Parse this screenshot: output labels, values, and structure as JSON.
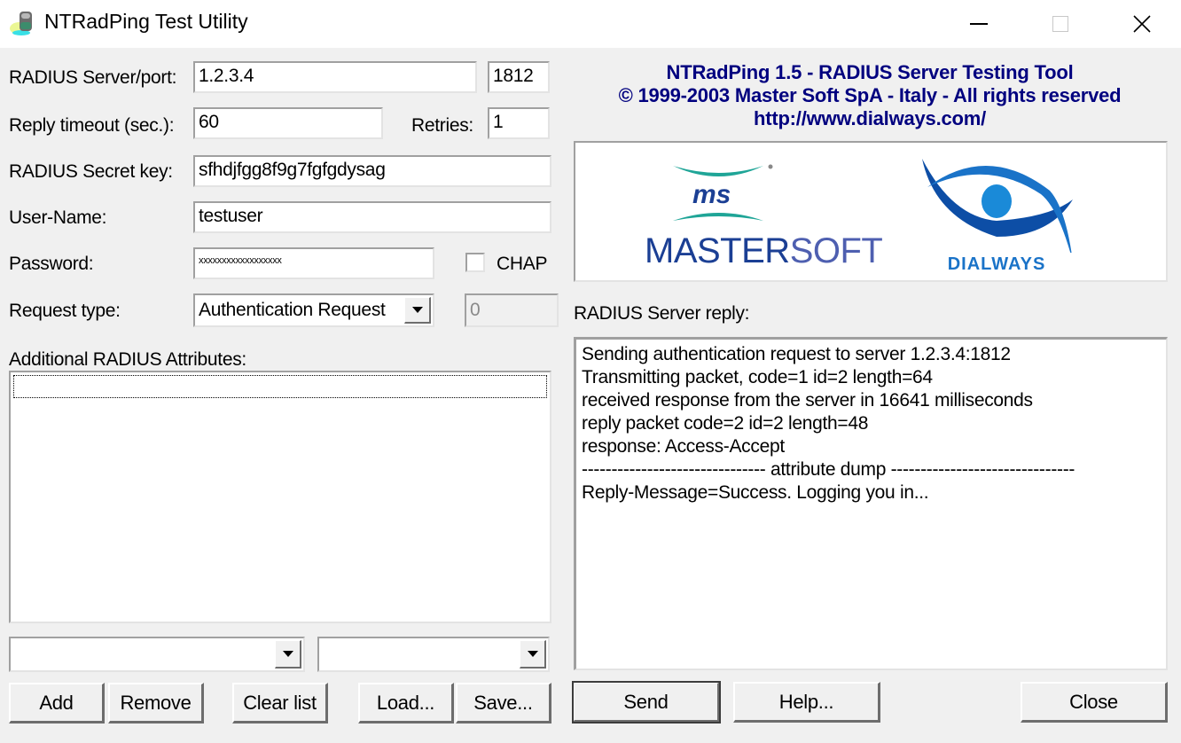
{
  "window": {
    "title": "NTRadPing Test Utility",
    "controls": {
      "minimize": "minimize-icon",
      "maximize": "maximize-icon",
      "close": "close-icon"
    }
  },
  "form": {
    "server_label": "RADIUS Server/port:",
    "server_value": "1.2.3.4",
    "port_value": "1812",
    "timeout_label": "Reply timeout (sec.):",
    "timeout_value": "60",
    "retries_label": "Retries:",
    "retries_value": "1",
    "secret_label": "RADIUS Secret key:",
    "secret_value": "sfhdjfgg8f9g7fgfgdysag",
    "username_label": "User-Name:",
    "username_value": "testuser",
    "password_label": "Password:",
    "password_value": "xxxxxxxxxxxxxxxxxx",
    "chap_label": "CHAP",
    "chap_checked": false,
    "request_type_label": "Request type:",
    "request_type_value": "Authentication Request",
    "request_extra_value": "0"
  },
  "attributes": {
    "label": "Additional RADIUS Attributes:",
    "items": [],
    "attr_combo_value": "",
    "value_combo_value": "",
    "buttons": {
      "add": "Add",
      "remove": "Remove",
      "clear": "Clear list",
      "load": "Load...",
      "save": "Save..."
    }
  },
  "banner": {
    "line1": "NTRadPing 1.5 - RADIUS Server Testing Tool",
    "line2": "© 1999-2003 Master Soft SpA - Italy - All rights reserved",
    "line3": "http://www.dialways.com/",
    "logo_left_mark": "ms",
    "logo_left_name_bold": "MASTER",
    "logo_left_name_light": "SOFT",
    "logo_right_name": "DIALWAYS",
    "colors": {
      "banner_text": "#00007f",
      "ms_teal": "#1fa597",
      "ms_blue": "#1b3f94",
      "dialways_blue": "#1a73c8"
    }
  },
  "reply": {
    "label": "RADIUS Server reply:",
    "lines": [
      "Sending authentication request to server 1.2.3.4:1812",
      "Transmitting packet, code=1 id=2 length=64",
      "received response from the server in 16641 milliseconds",
      "reply packet code=2 id=2 length=48",
      "response: Access-Accept",
      "------------------------------- attribute dump -------------------------------",
      "Reply-Message=Success. Logging you in..."
    ]
  },
  "actions": {
    "send": "Send",
    "help": "Help...",
    "close": "Close"
  }
}
